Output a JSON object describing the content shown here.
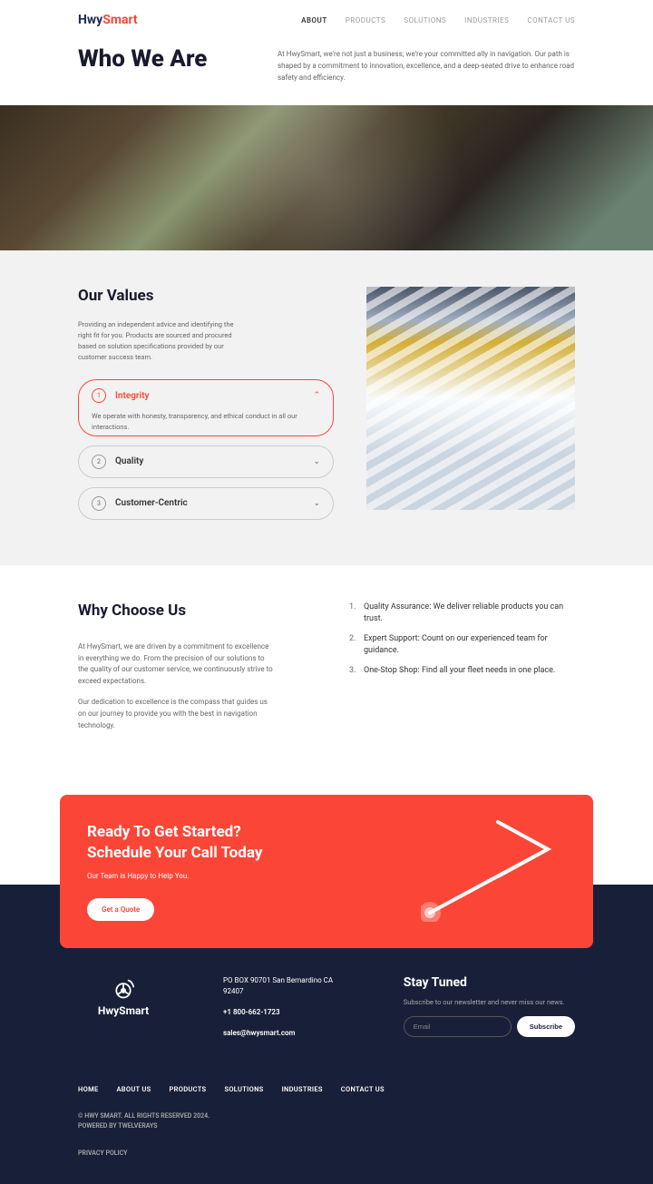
{
  "brand": {
    "hwy": "Hwy",
    "smart": "Smart"
  },
  "nav": [
    {
      "label": "About",
      "active": true
    },
    {
      "label": "Products",
      "active": false
    },
    {
      "label": "Solutions",
      "active": false
    },
    {
      "label": "Industries",
      "active": false
    },
    {
      "label": "Contact Us",
      "active": false
    }
  ],
  "hero": {
    "title": "Who We Are",
    "desc": "At HwySmart, we're not just a business; we're your committed ally in navigation. Our path is shaped by a commitment to innovation, excellence, and a deep-seated drive to enhance road safety and efficiency."
  },
  "values": {
    "title": "Our Values",
    "desc": "Providing an independent advice and identifying the right fit for you. Products are sourced and procured based on solution specifications provided by our customer success team.",
    "items": [
      {
        "num": "1",
        "label": "Integrity",
        "expanded": true,
        "content": "We operate with honesty, transparency, and ethical conduct in all our interactions."
      },
      {
        "num": "2",
        "label": "Quality",
        "expanded": false
      },
      {
        "num": "3",
        "label": "Customer-Centric",
        "expanded": false
      }
    ]
  },
  "why": {
    "title": "Why Choose Us",
    "para1": "At HwySmart, we are driven by a commitment to excellence in everything we do. From the precision of our solutions to the quality of our customer service, we continuously strive to exceed expectations.",
    "para2": "Our dedication to excellence is the compass that guides us on our journey to provide you with the best in navigation technology.",
    "list": [
      "Quality Assurance: We deliver reliable products you can trust.",
      "Expert Support: Count on our experienced team for guidance.",
      "One-Stop Shop: Find all your fleet needs in one place."
    ]
  },
  "cta": {
    "title1": "Ready To Get Started?",
    "title2": "Schedule Your Call Today",
    "sub": "Our Team is Happy to Help You.",
    "button": "Get a Quote"
  },
  "footer": {
    "logo_text": "HwySmart",
    "address": "PO BOX 90701 San Bernardino CA 92407",
    "phone": "+1 800-662-1723",
    "email": "sales@hwysmart.com",
    "newsletter": {
      "title": "Stay Tuned",
      "desc": "Subscribe to our newsletter and never miss our news.",
      "placeholder": "Email",
      "button": "Subscribe"
    },
    "nav": [
      "Home",
      "About Us",
      "Products",
      "Solutions",
      "Industries",
      "Contact Us"
    ],
    "copyright": "© HWY SMART. ALL RIGHTS RESERVED 2024.",
    "powered": "POWERED BY TWELVERAYS",
    "privacy": "Privacy Policy"
  }
}
